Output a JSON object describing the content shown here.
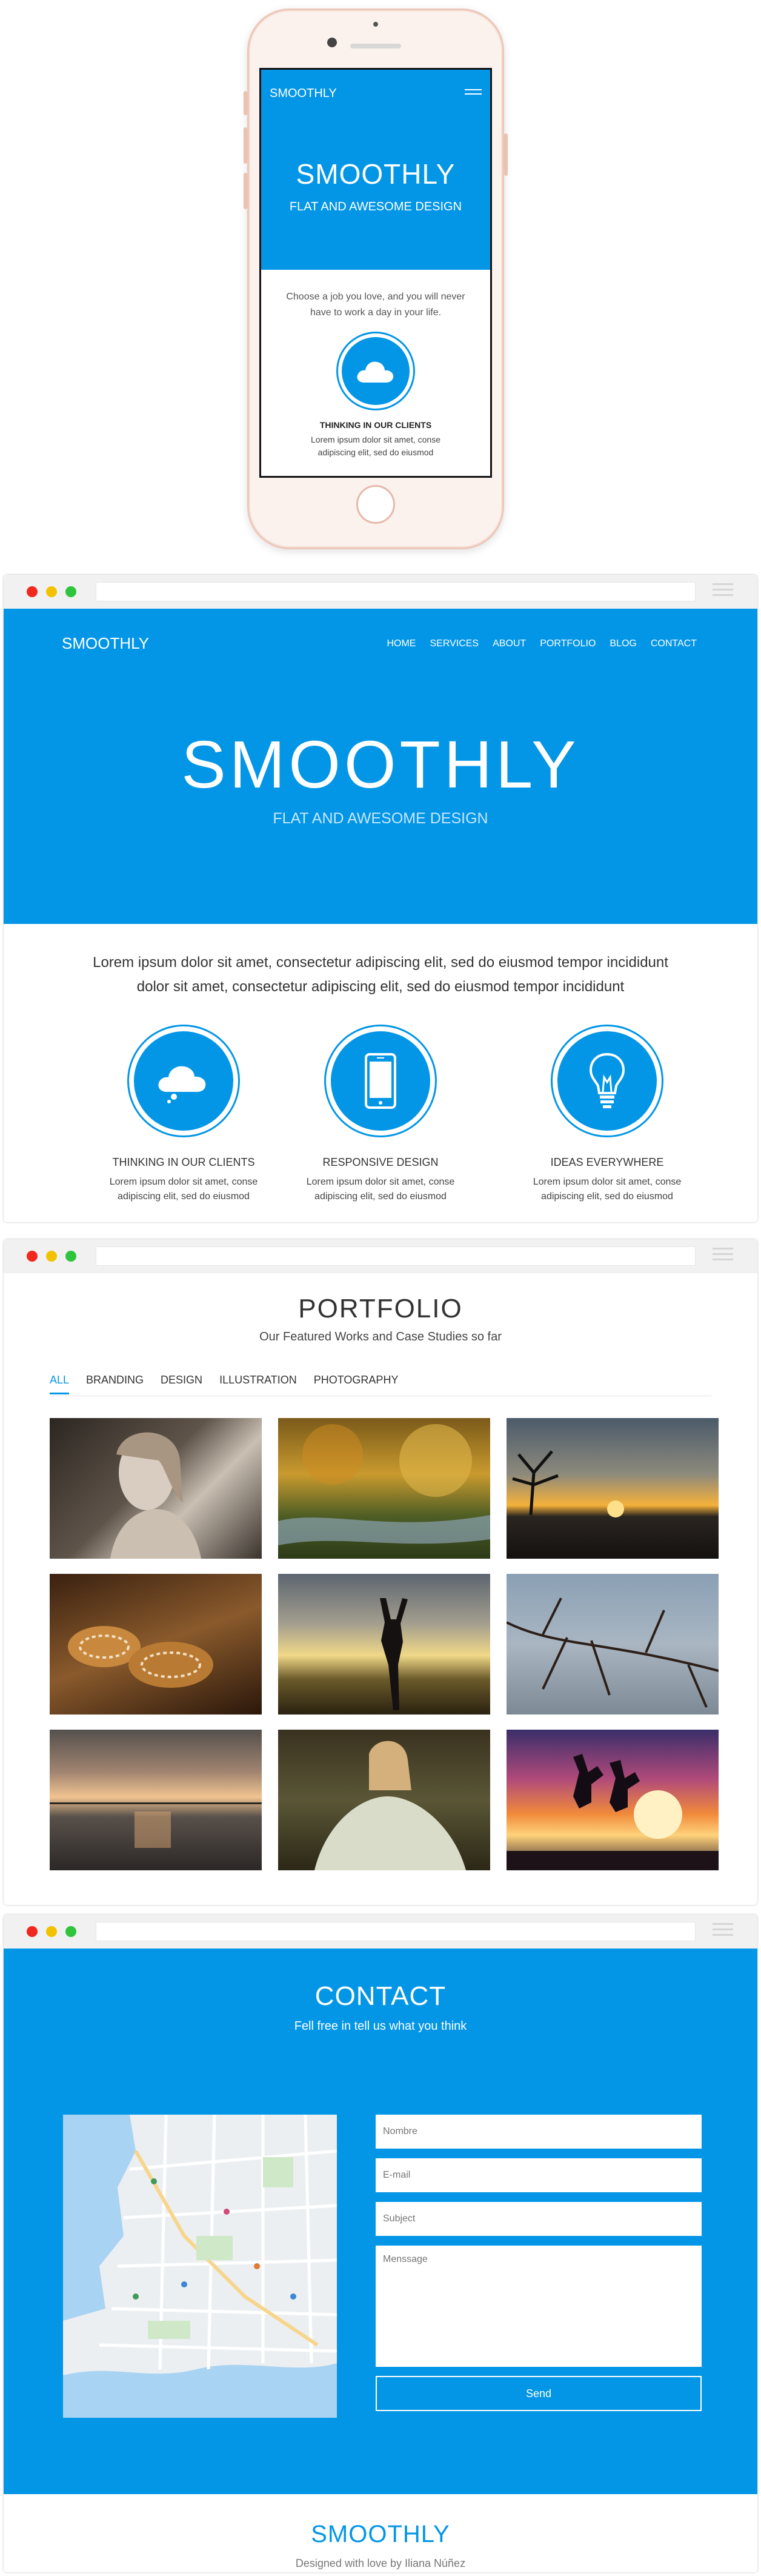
{
  "phone": {
    "logo": "SMOOTHLY",
    "title": "SMOOTHLY",
    "subtitle": "FLAT AND AWESOME DESIGN",
    "quote": "Choose a job you love, and you will never have to work a day in your life.",
    "feature_title": "THINKING IN OUR CLIENTS",
    "feature_text": "Lorem ipsum dolor sit amet, conse adipiscing elit, sed do eiusmod"
  },
  "home": {
    "logo": "SMOOTHLY",
    "nav": [
      "HOME",
      "SERVICES",
      "ABOUT",
      "PORTFOLIO",
      "BLOG",
      "CONTACT"
    ],
    "title": "SMOOTHLY",
    "subtitle": "FLAT AND AWESOME DESIGN",
    "intro": "Lorem ipsum dolor sit amet, consectetur adipiscing elit, sed do eiusmod tempor incididunt dolor sit amet, consectetur adipiscing elit, sed do eiusmod tempor incididunt",
    "features": [
      {
        "icon": "cloud-icon",
        "title": "THINKING IN OUR CLIENTS",
        "text": "Lorem ipsum dolor sit amet, conse adipiscing elit, sed do eiusmod"
      },
      {
        "icon": "smartphone-icon",
        "title": "RESPONSIVE DESIGN",
        "text": "Lorem ipsum dolor sit amet, conse adipiscing elit, sed do eiusmod"
      },
      {
        "icon": "lightbulb-icon",
        "title": "IDEAS EVERYWHERE",
        "text": "Lorem ipsum dolor sit amet, conse adipiscing elit, sed do eiusmod"
      }
    ]
  },
  "portfolio": {
    "title": "PORTFOLIO",
    "subtitle": "Our Featured Works and Case Studies so far",
    "filters": [
      "ALL",
      "BRANDING",
      "DESIGN",
      "ILLUSTRATION",
      "PHOTOGRAPHY"
    ],
    "active_filter": "ALL"
  },
  "contact": {
    "title": "CONTACT",
    "subtitle": "Fell free in tell us what you think",
    "name_placeholder": "Nombre",
    "email_placeholder": "E-mail",
    "subject_placeholder": "Subject",
    "message_placeholder": "Menssage",
    "send_label": "Send"
  },
  "footer": {
    "logo": "SMOOTHLY",
    "credit": "Designed with love by Iliana Núñez"
  },
  "colors": {
    "accent": "#0396e6",
    "dot_red": "#f0281e",
    "dot_yellow": "#f2c200",
    "dot_green": "#2ec43b"
  }
}
